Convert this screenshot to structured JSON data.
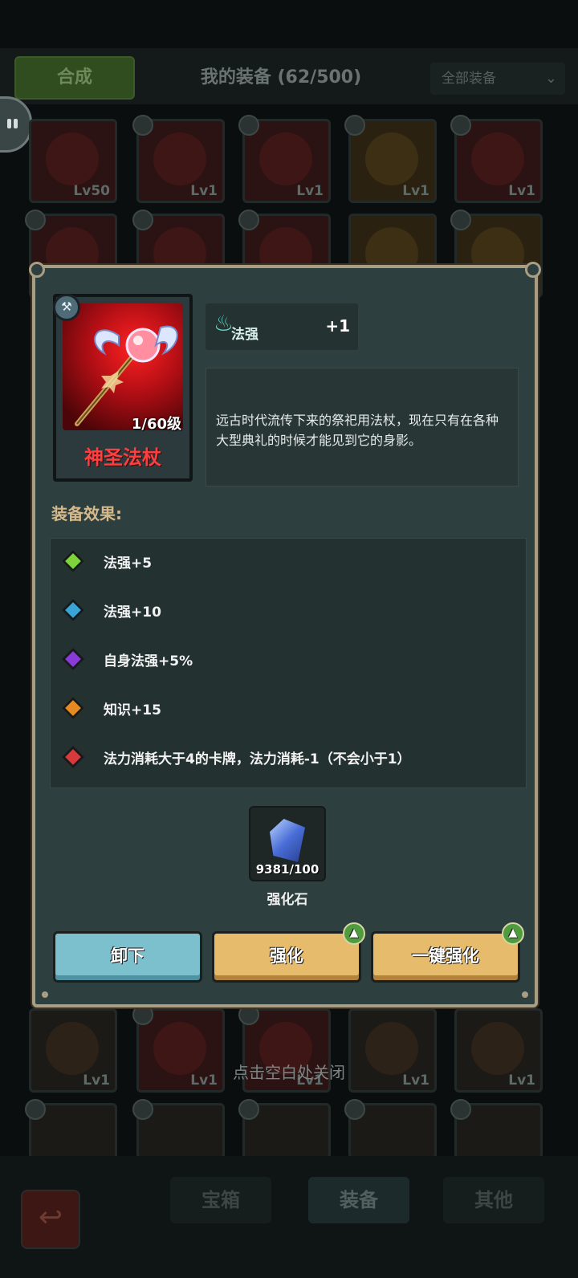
{
  "background": {
    "synth_button": "合成",
    "title": "我的装备 (62/500)",
    "filter": {
      "selected": "全部装备"
    },
    "grid_levels": [
      "Lv50",
      "Lv1",
      "Lv1",
      "Lv1",
      "Lv1"
    ],
    "lower_grid_levels": [
      "Lv1",
      "Lv1",
      "Lv1",
      "Lv1",
      "Lv1"
    ],
    "close_hint": "点击空白处关闭",
    "nav_tabs": [
      "宝箱",
      "装备",
      "其他"
    ]
  },
  "item": {
    "name": "神圣法杖",
    "level": "1/60级",
    "stat_label": "法强",
    "stat_value": "+1",
    "description": "远古时代流传下来的祭祀用法杖，现在只有在各种大型典礼的时候才能见到它的身影。"
  },
  "effects": {
    "title": "装备效果:",
    "items": [
      {
        "text": "法强+5",
        "color": "#7ed33a"
      },
      {
        "text": "法强+10",
        "color": "#3aa4d6"
      },
      {
        "text": "自身法强+5%",
        "color": "#8a3ad6"
      },
      {
        "text": "知识+15",
        "color": "#e58a22"
      },
      {
        "text": "法力消耗大于4的卡牌，法力消耗-1（不会小于1）",
        "color": "#d63a3a"
      }
    ]
  },
  "material": {
    "count": "9381/100",
    "name": "强化石"
  },
  "buttons": {
    "unequip": "卸下",
    "enhance": "强化",
    "one_click": "一键强化"
  },
  "icons": {
    "badge": "wrench-icon",
    "stat": "flame-icon",
    "upgrade": "arrow-up-icon",
    "back": "return-arrow-icon"
  }
}
